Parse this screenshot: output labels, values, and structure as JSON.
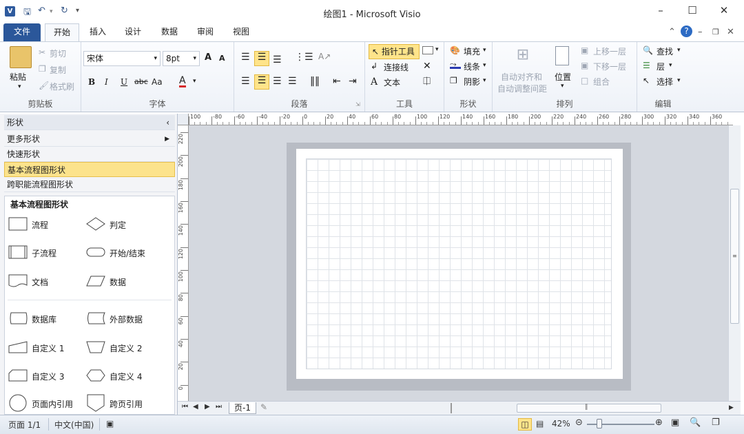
{
  "title_bar": {
    "title": "绘图1 - Microsoft Visio",
    "app_icon": "V"
  },
  "tabs": [
    "文件",
    "开始",
    "插入",
    "设计",
    "数据",
    "审阅",
    "视图"
  ],
  "active_tab": "开始",
  "ribbon": {
    "clipboard": {
      "label": "剪贴板",
      "paste": "粘贴",
      "cut": "剪切",
      "copy": "复制",
      "format_painter": "格式刷"
    },
    "font": {
      "label": "字体",
      "family": "宋体",
      "size": "8pt",
      "bold": "B",
      "italic": "I",
      "underline": "U",
      "strike": "abc",
      "case": "Aa",
      "color": "A",
      "grow": "A",
      "shrink": "A"
    },
    "paragraph": {
      "label": "段落"
    },
    "tools": {
      "label": "工具",
      "pointer": "指针工具",
      "connector": "连接线",
      "text": "文本"
    },
    "shape": {
      "label": "形状",
      "fill": "填充",
      "line": "线条",
      "shadow": "阴影"
    },
    "arrange": {
      "label": "排列",
      "auto_align_1": "自动对齐和",
      "auto_align_2": "自动调整间距",
      "position": "位置",
      "bring_forward": "上移一层",
      "send_backward": "下移一层",
      "group": "组合"
    },
    "edit": {
      "label": "编辑",
      "find": "查找",
      "layer": "层",
      "select": "选择"
    }
  },
  "shapes_pane": {
    "title": "形状",
    "more_shapes": "更多形状",
    "quick_shapes": "快速形状",
    "basic_flowchart": "基本流程图形状",
    "cross_functional": "跨职能流程图形状",
    "stencil_title": "基本流程图形状",
    "items": [
      "流程",
      "判定",
      "子流程",
      "开始/结束",
      "文档",
      "数据",
      "数据库",
      "外部数据",
      "自定义 1",
      "自定义 2",
      "自定义 3",
      "自定义 4",
      "页面内引用",
      "跨页引用"
    ]
  },
  "page_tab": "页-1",
  "status": {
    "page": "页面 1/1",
    "language": "中文(中国)",
    "zoom": "42%"
  },
  "ruler": {
    "top": [
      "100",
      "-80",
      "-60",
      "-40",
      "-20",
      "0",
      "20",
      "40",
      "60",
      "80",
      "100",
      "120",
      "140",
      "160",
      "180",
      "200",
      "220",
      "240",
      "260",
      "280",
      "300",
      "320",
      "340",
      "360"
    ],
    "left": [
      "220",
      "200",
      "180",
      "160",
      "140",
      "120",
      "100",
      "80",
      "60",
      "40",
      "20",
      "0"
    ]
  }
}
